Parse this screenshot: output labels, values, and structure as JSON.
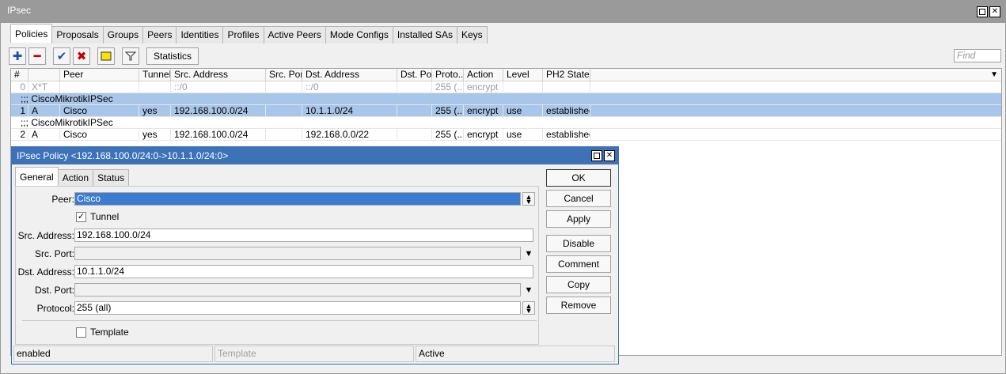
{
  "window": {
    "title": "IPsec"
  },
  "tabs": [
    "Policies",
    "Proposals",
    "Groups",
    "Peers",
    "Identities",
    "Profiles",
    "Active Peers",
    "Mode Configs",
    "Installed SAs",
    "Keys"
  ],
  "toolbar": {
    "statistics_label": "Statistics",
    "find_placeholder": "Find"
  },
  "columns": [
    "#",
    "",
    "Peer",
    "Tunnel",
    "Src. Address",
    "Src. Port",
    "Dst. Address",
    "Dst. Port",
    "Proto...",
    "Action",
    "Level",
    "PH2 State"
  ],
  "rows": [
    {
      "kind": "row",
      "num": "0",
      "flags": "X*T",
      "peer": "",
      "tunnel": "",
      "src": "::/0",
      "src_port": "",
      "dst": "::/0",
      "dst_port": "",
      "proto": "255 (...",
      "action": "encrypt",
      "level": "",
      "ph2": "",
      "style": "grey"
    },
    {
      "kind": "comment",
      "text": ";;; CiscoMikrotikIPSec",
      "style": "sel"
    },
    {
      "kind": "row",
      "num": "1",
      "flags": "A",
      "peer": "Cisco",
      "tunnel": "yes",
      "src": "192.168.100.0/24",
      "src_port": "",
      "dst": "10.1.1.0/24",
      "dst_port": "",
      "proto": "255 (...",
      "action": "encrypt",
      "level": "use",
      "ph2": "established",
      "style": "sel"
    },
    {
      "kind": "comment",
      "text": ";;; CiscoMikrotikIPSec",
      "style": ""
    },
    {
      "kind": "row",
      "num": "2",
      "flags": "A",
      "peer": "Cisco",
      "tunnel": "yes",
      "src": "192.168.100.0/24",
      "src_port": "",
      "dst": "192.168.0.0/22",
      "dst_port": "",
      "proto": "255 (...",
      "action": "encrypt",
      "level": "use",
      "ph2": "established",
      "style": ""
    }
  ],
  "dialog": {
    "title": "IPsec Policy <192.168.100.0/24:0->10.1.1.0/24:0>",
    "tabs": [
      "General",
      "Action",
      "Status"
    ],
    "peer_label": "Peer:",
    "peer_value": "Cisco",
    "tunnel_label": "Tunnel",
    "src_address_label": "Src. Address:",
    "src_address_value": "192.168.100.0/24",
    "src_port_label": "Src. Port:",
    "src_port_value": "",
    "dst_address_label": "Dst. Address:",
    "dst_address_value": "10.1.1.0/24",
    "dst_port_label": "Dst. Port:",
    "dst_port_value": "",
    "protocol_label": "Protocol:",
    "protocol_value": "255 (all)",
    "template_label": "Template",
    "buttons": {
      "ok": "OK",
      "cancel": "Cancel",
      "apply": "Apply",
      "disable": "Disable",
      "comment": "Comment",
      "copy": "Copy",
      "remove": "Remove"
    },
    "status": {
      "enabled": "enabled",
      "template": "Template",
      "active": "Active"
    }
  },
  "colors": {
    "selection": "#a8c5ea",
    "dialog_title": "#3d72b8",
    "titlebar": "#9a9a9a"
  }
}
